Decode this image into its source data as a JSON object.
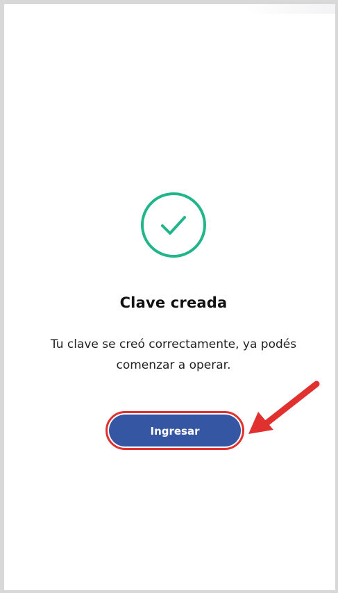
{
  "success": {
    "icon": "check-circle-icon",
    "title": "Clave creada",
    "message": "Tu clave se creó correctamente, ya podés comenzar a operar."
  },
  "actions": {
    "primary_label": "Ingresar"
  },
  "annotation": {
    "icon": "red-arrow-icon"
  },
  "colors": {
    "success_green": "#22b58a",
    "button_blue": "#3556a3",
    "highlight_red": "#e0312f",
    "text": "#111111"
  }
}
